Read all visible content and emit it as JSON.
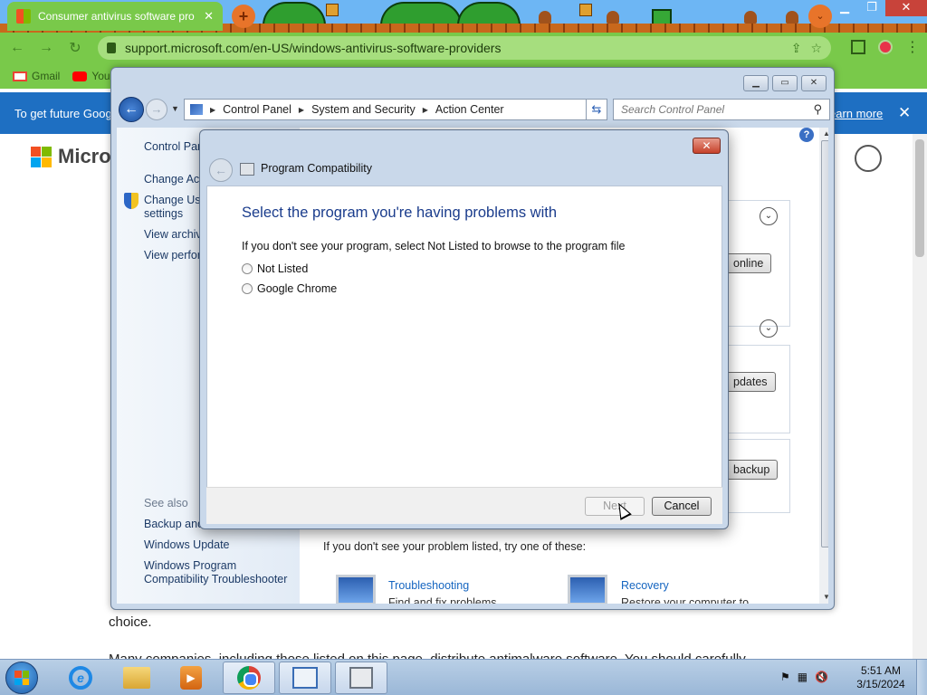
{
  "browser": {
    "tab_title": "Consumer antivirus software pro",
    "url": "support.microsoft.com/en-US/windows-antivirus-software-providers",
    "bookmarks": [
      "Gmail",
      "YouTube"
    ],
    "info_bar": {
      "text": "To get future Goog",
      "learn_more": "earn more"
    },
    "page": {
      "brand": "Microso",
      "choice_text": "choice.",
      "partial_line": "Many companies, including those listed on this page, distribute antimalware software. You should carefully"
    }
  },
  "control_panel": {
    "breadcrumb": [
      "Control Panel",
      "System and Security",
      "Action Center"
    ],
    "search_placeholder": "Search Control Panel",
    "sidebar": {
      "home": "Control Pan",
      "items": [
        "Change Act",
        "Change Use settings",
        "View archiv",
        "View perfor"
      ],
      "see_also_label": "See also",
      "see_also": [
        "Backup and",
        "Windows Update",
        "Windows Program Compatibility Troubleshooter"
      ]
    },
    "buttons": [
      "online",
      "pdates",
      "backup"
    ],
    "not_listed_msg": "If you don't see your problem listed, try one of these:",
    "links": [
      {
        "title": "Troubleshooting",
        "subtitle": "Find and fix problems"
      },
      {
        "title": "Recovery",
        "subtitle": "Restore your computer to"
      }
    ]
  },
  "dialog": {
    "title": "Program Compatibility",
    "heading": "Select the program you're having problems with",
    "instruction": "If you don't see your program, select Not Listed to browse to the program file",
    "options": [
      "Not Listed",
      "Google Chrome"
    ],
    "next_label": "Next",
    "cancel_label": "Cancel"
  },
  "taskbar": {
    "time": "5:51 AM",
    "date": "3/15/2024"
  },
  "colors": {
    "chrome_theme": "#79c94a",
    "info_bar": "#1e6fc2",
    "dialog_heading": "#1a3c8c",
    "link": "#1565c0"
  }
}
